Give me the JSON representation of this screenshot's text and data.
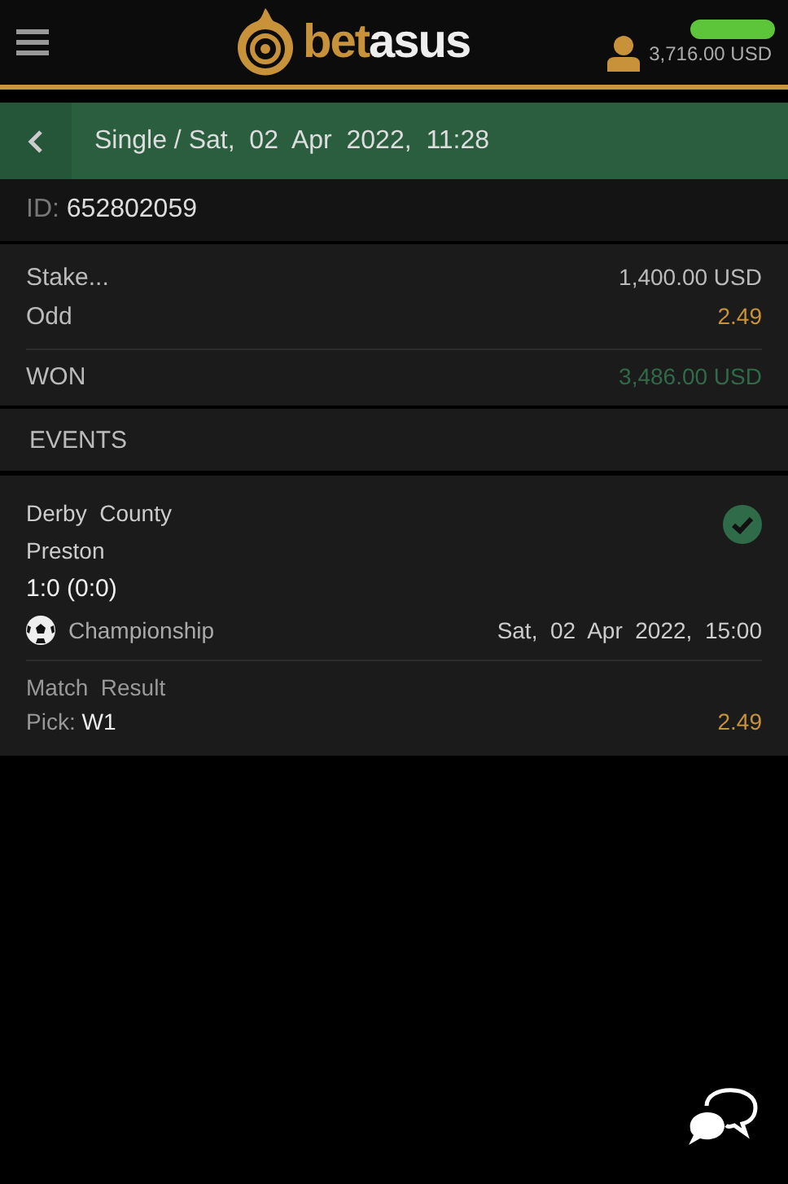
{
  "header": {
    "logo": {
      "prefix": "bet",
      "suffix": "asus"
    },
    "balance": "3,716.00 USD"
  },
  "title_bar": {
    "title": "Single / Sat,  02  Apr  2022,  11:28"
  },
  "bet": {
    "id_label": "ID:",
    "id": "652802059",
    "stake_label": "Stake...",
    "stake": "1,400.00 USD",
    "odd_label": "Odd",
    "odd": "2.49",
    "result_label": "WON",
    "result_amount": "3,486.00 USD",
    "won": true
  },
  "events_heading": "EVENTS",
  "events": [
    {
      "home": "Derby  County",
      "away": "Preston",
      "score": "1:0 (0:0)",
      "won": true,
      "kind": "football",
      "league": "Championship",
      "date": "Sat,  02  Apr  2022,  15:00",
      "market": "Match  Result",
      "pick_label": "Pick:",
      "pick": "W1",
      "odd": "2.49"
    }
  ]
}
